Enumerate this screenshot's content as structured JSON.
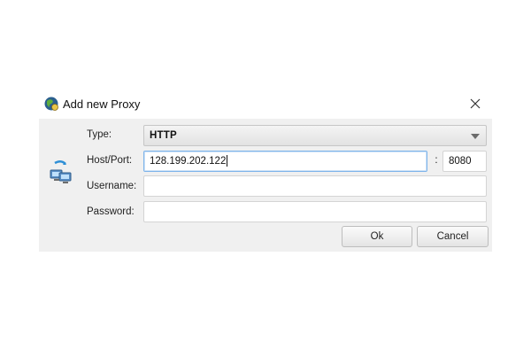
{
  "dialog": {
    "title": "Add new Proxy",
    "title_icon": "globe-icon",
    "side_icon": "network-computers-icon",
    "close_icon": "close-icon"
  },
  "form": {
    "type_label": "Type:",
    "type_value": "HTTP",
    "host_port_label": "Host/Port:",
    "host_value": "128.199.202.122",
    "port_separator": ":",
    "port_value": "8080",
    "username_label": "Username:",
    "username_value": "",
    "password_label": "Password:",
    "password_value": ""
  },
  "buttons": {
    "ok_label": "Ok",
    "cancel_label": "Cancel"
  },
  "colors": {
    "dialog_background": "#f0f0f0",
    "focus_border": "#7eb4ea"
  }
}
